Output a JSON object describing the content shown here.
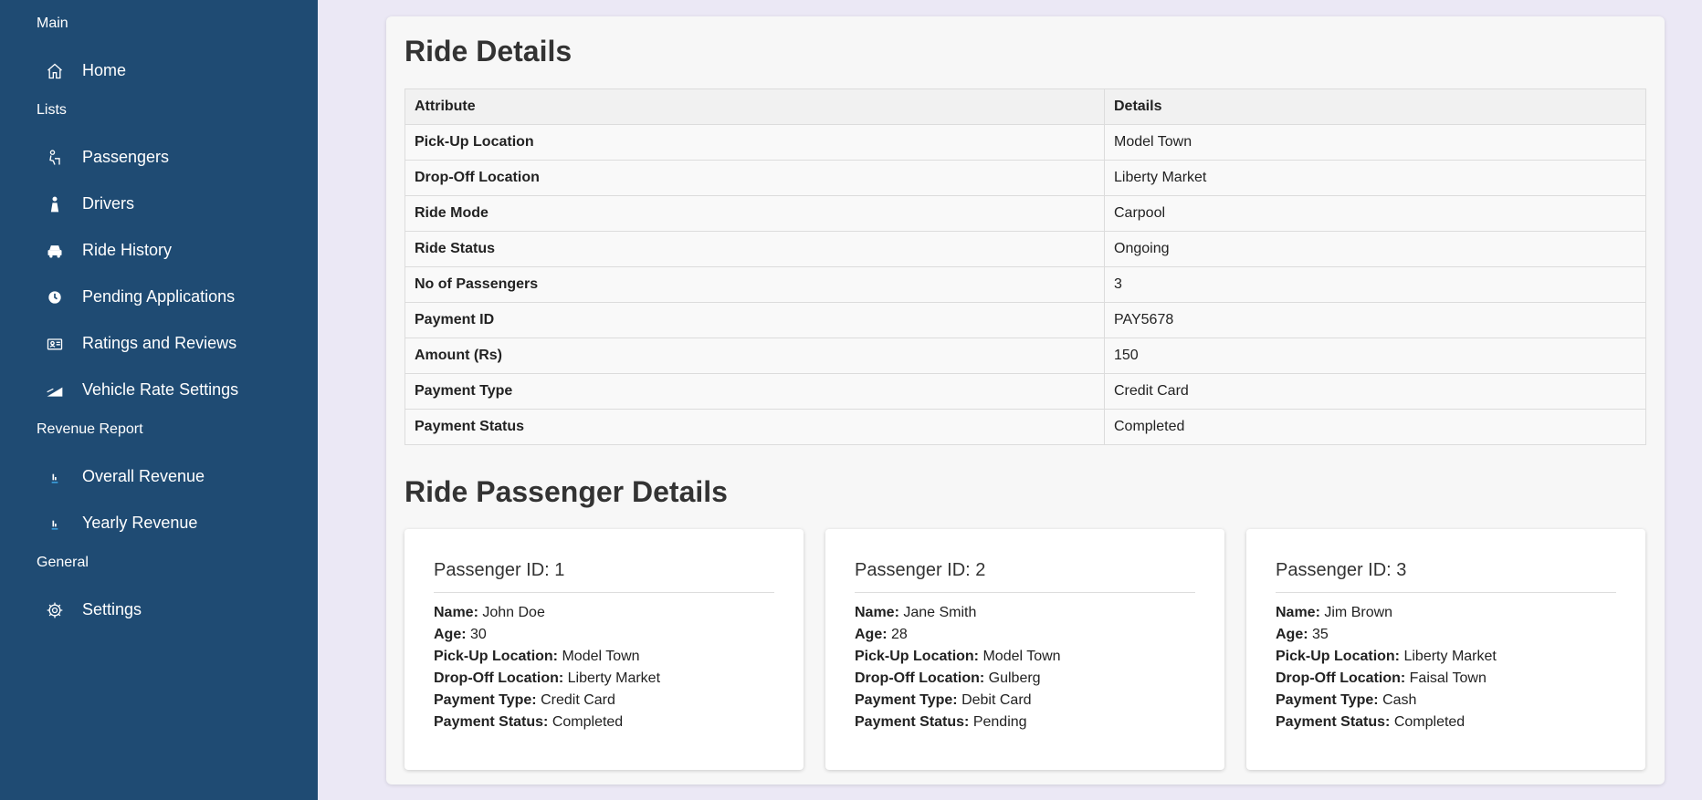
{
  "sidebar": {
    "sections": [
      {
        "title": "Main",
        "items": [
          {
            "label": "Home",
            "icon": "home-icon"
          }
        ]
      },
      {
        "title": "Lists",
        "items": [
          {
            "label": "Passengers",
            "icon": "passenger-icon"
          },
          {
            "label": "Drivers",
            "icon": "driver-icon"
          },
          {
            "label": "Ride History",
            "icon": "car-icon"
          },
          {
            "label": "Pending Applications",
            "icon": "clock-icon"
          },
          {
            "label": "Ratings and Reviews",
            "icon": "id-card-icon"
          },
          {
            "label": "Vehicle Rate Settings",
            "icon": "rate-chart-icon"
          }
        ]
      },
      {
        "title": "Revenue Report",
        "items": [
          {
            "label": "Overall Revenue",
            "icon": "bar-chart-icon"
          },
          {
            "label": "Yearly Revenue",
            "icon": "bar-chart-icon"
          }
        ]
      },
      {
        "title": "General",
        "items": [
          {
            "label": "Settings",
            "icon": "gear-icon"
          }
        ]
      }
    ]
  },
  "ride_details": {
    "heading": "Ride Details",
    "columns": [
      "Attribute",
      "Details"
    ],
    "rows": [
      [
        "Pick-Up Location",
        "Model Town"
      ],
      [
        "Drop-Off Location",
        "Liberty Market"
      ],
      [
        "Ride Mode",
        "Carpool"
      ],
      [
        "Ride Status",
        "Ongoing"
      ],
      [
        "No of Passengers",
        "3"
      ],
      [
        "Payment ID",
        "PAY5678"
      ],
      [
        "Amount (Rs)",
        "150"
      ],
      [
        "Payment Type",
        "Credit Card"
      ],
      [
        "Payment Status",
        "Completed"
      ]
    ]
  },
  "passengers": {
    "heading": "Ride Passenger Details",
    "labels": {
      "name": "Name:",
      "age": "Age:",
      "pickup": "Pick-Up Location:",
      "dropoff": "Drop-Off Location:",
      "payment_type": "Payment Type:",
      "payment_status": "Payment Status:"
    },
    "cards": [
      {
        "title": "Passenger ID: 1",
        "name": "John Doe",
        "age": "30",
        "pickup": "Model Town",
        "dropoff": "Liberty Market",
        "payment_type": "Credit Card",
        "payment_status": "Completed"
      },
      {
        "title": "Passenger ID: 2",
        "name": "Jane Smith",
        "age": "28",
        "pickup": "Model Town",
        "dropoff": "Gulberg",
        "payment_type": "Debit Card",
        "payment_status": "Pending"
      },
      {
        "title": "Passenger ID: 3",
        "name": "Jim Brown",
        "age": "35",
        "pickup": "Liberty Market",
        "dropoff": "Faisal Town",
        "payment_type": "Cash",
        "payment_status": "Completed"
      }
    ]
  },
  "colors": {
    "sidebar_bg": "#1f4b73",
    "page_bg": "#ebe8f5",
    "card_bg": "#f7f7f7"
  }
}
